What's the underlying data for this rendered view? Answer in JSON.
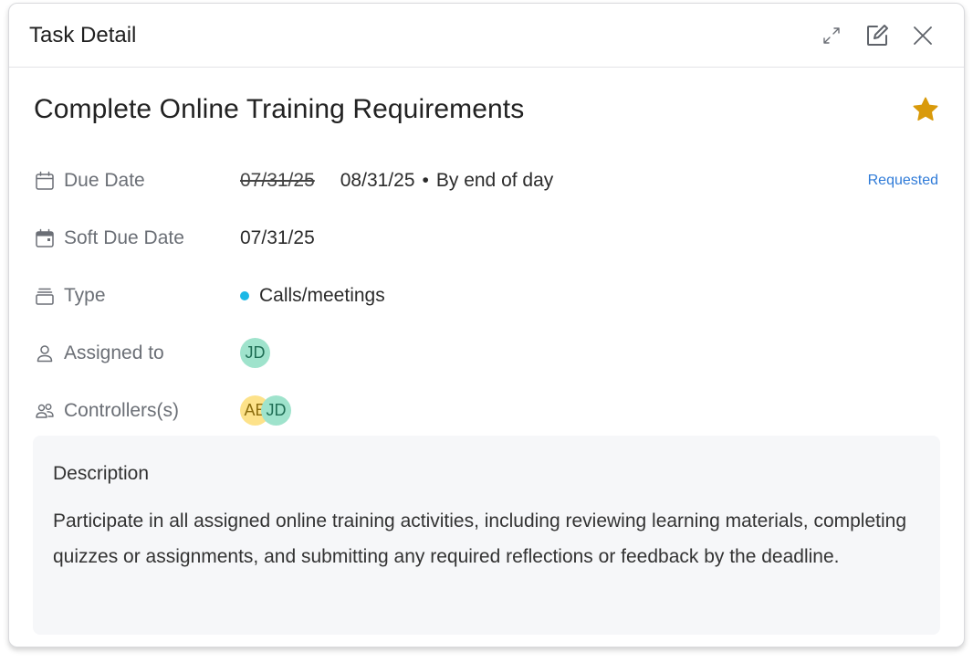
{
  "header": {
    "title": "Task Detail",
    "icons": [
      "expand-icon",
      "edit-icon",
      "close-icon"
    ]
  },
  "task": {
    "title": "Complete Online Training Requirements",
    "starred": true,
    "star_color": "#d99a0b"
  },
  "fields": {
    "due_date": {
      "label": "Due Date",
      "old_value": "07/31/25",
      "new_value": "08/31/25",
      "separator": "•",
      "note": "By end of day",
      "status": "Requested"
    },
    "soft_due_date": {
      "label": "Soft Due Date",
      "value": "07/31/25"
    },
    "type": {
      "label": "Type",
      "value": "Calls/meetings",
      "dot_color": "#1bb8e6"
    },
    "assigned_to": {
      "label": "Assigned to",
      "avatars": [
        "JD"
      ]
    },
    "controllers": {
      "label": "Controllers(s)",
      "avatars": [
        "AE",
        "JD"
      ]
    }
  },
  "description": {
    "heading": "Description",
    "body": "Participate in all assigned online training activities, including reviewing learning materials, completing quizzes or assignments, and submitting any required reflections or feedback by the deadline."
  },
  "colors": {
    "link": "#2f7bd8",
    "avatar_jd_bg": "#9fe3cc",
    "avatar_ae_bg": "#fde28a"
  }
}
